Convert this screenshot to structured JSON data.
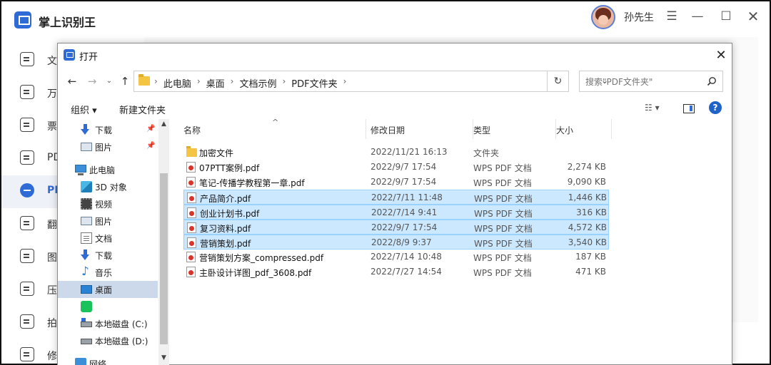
{
  "app": {
    "title": "掌上识别王",
    "user_name": "孙先生",
    "menu_icon": "☰",
    "minimize_icon": "—",
    "maximize_icon": "☐",
    "close_icon": "✕",
    "sidebar": [
      {
        "label": "文",
        "icon": "document-icon",
        "active": false
      },
      {
        "label": "万",
        "icon": "scan-icon",
        "active": false
      },
      {
        "label": "票",
        "icon": "ticket-icon",
        "active": false
      },
      {
        "label": "PD",
        "icon": "pdf-icon",
        "active": false
      },
      {
        "label": "PD",
        "icon": "pdf-tool-icon",
        "active": true
      },
      {
        "label": "翻",
        "icon": "translate-icon",
        "active": false
      },
      {
        "label": "图",
        "icon": "image-icon",
        "active": false
      },
      {
        "label": "压",
        "icon": "compress-icon",
        "active": false
      },
      {
        "label": "拍",
        "icon": "camera-icon",
        "active": false
      },
      {
        "label": "修",
        "icon": "repair-icon",
        "active": false
      }
    ]
  },
  "dialog": {
    "title": "打开",
    "close_icon": "✕",
    "nav": {
      "back": "←",
      "forward": "→",
      "recent": "⌄",
      "up": "↑"
    },
    "breadcrumbs": [
      "此电脑",
      "桌面",
      "文档示例",
      "PDF文件夹"
    ],
    "breadcrumb_sep": "›",
    "refresh_icon": "↻",
    "dropdown_icon": "⌄",
    "search_placeholder": "搜索\"PDF文件夹\"",
    "toolbar": {
      "organize": "组织 ▾",
      "new_folder": "新建文件夹",
      "view_icon": "☷ ▾",
      "help": "?"
    },
    "nav_pane": [
      {
        "label": "下载",
        "icon": "download",
        "pinned": true,
        "indent": 1
      },
      {
        "label": "图片",
        "icon": "pictures",
        "pinned": true,
        "indent": 1
      },
      {
        "label": "此电脑",
        "icon": "pc",
        "pinned": false,
        "indent": 0
      },
      {
        "label": "3D 对象",
        "icon": "3d",
        "pinned": false,
        "indent": 1
      },
      {
        "label": "视频",
        "icon": "video",
        "pinned": false,
        "indent": 1
      },
      {
        "label": "图片",
        "icon": "pictures",
        "pinned": false,
        "indent": 1
      },
      {
        "label": "文档",
        "icon": "documents",
        "pinned": false,
        "indent": 1
      },
      {
        "label": "下载",
        "icon": "download",
        "pinned": false,
        "indent": 1
      },
      {
        "label": "音乐",
        "icon": "music",
        "pinned": false,
        "indent": 1
      },
      {
        "label": "桌面",
        "icon": "desktop",
        "pinned": false,
        "indent": 1,
        "selected": true
      },
      {
        "label": "",
        "icon": "app",
        "pinned": false,
        "indent": 1
      },
      {
        "label": "本地磁盘 (C:)",
        "icon": "disk-c",
        "pinned": false,
        "indent": 1
      },
      {
        "label": "本地磁盘 (D:)",
        "icon": "disk",
        "pinned": false,
        "indent": 1
      },
      {
        "label": "网络",
        "icon": "network",
        "pinned": false,
        "indent": 0
      }
    ],
    "pin_icon": "📌",
    "scroll_up": "▲",
    "scroll_down": "▼",
    "columns": {
      "name": "名称",
      "date": "修改日期",
      "type": "类型",
      "size": "大小",
      "sort_indicator": "^"
    },
    "files": [
      {
        "name": "加密文件",
        "date": "2022/11/21 16:13",
        "type": "文件夹",
        "size": "",
        "kind": "folder",
        "selected": false
      },
      {
        "name": "07PTT案例.pdf",
        "date": "2022/9/7 17:54",
        "type": "WPS PDF 文档",
        "size": "2,274 KB",
        "kind": "pdf",
        "selected": false
      },
      {
        "name": "笔记-传播学教程第一章.pdf",
        "date": "2022/9/7 17:54",
        "type": "WPS PDF 文档",
        "size": "9,090 KB",
        "kind": "pdf",
        "selected": false
      },
      {
        "name": "产品简介.pdf",
        "date": "2022/7/11 11:48",
        "type": "WPS PDF 文档",
        "size": "1,446 KB",
        "kind": "pdf",
        "selected": true
      },
      {
        "name": "创业计划书.pdf",
        "date": "2022/7/14 9:41",
        "type": "WPS PDF 文档",
        "size": "316 KB",
        "kind": "pdf",
        "selected": true
      },
      {
        "name": "复习资料.pdf",
        "date": "2022/9/7 17:54",
        "type": "WPS PDF 文档",
        "size": "4,572 KB",
        "kind": "pdf",
        "selected": true
      },
      {
        "name": "营销策划.pdf",
        "date": "2022/8/9 9:37",
        "type": "WPS PDF 文档",
        "size": "3,540 KB",
        "kind": "pdf",
        "selected": true
      },
      {
        "name": "营销策划方案_compressed.pdf",
        "date": "2022/7/14 10:48",
        "type": "WPS PDF 文档",
        "size": "187 KB",
        "kind": "pdf",
        "selected": false
      },
      {
        "name": "主卧设计详图_pdf_3608.pdf",
        "date": "2022/7/27 14:54",
        "type": "WPS PDF 文档",
        "size": "471 KB",
        "kind": "pdf",
        "selected": false
      }
    ]
  }
}
